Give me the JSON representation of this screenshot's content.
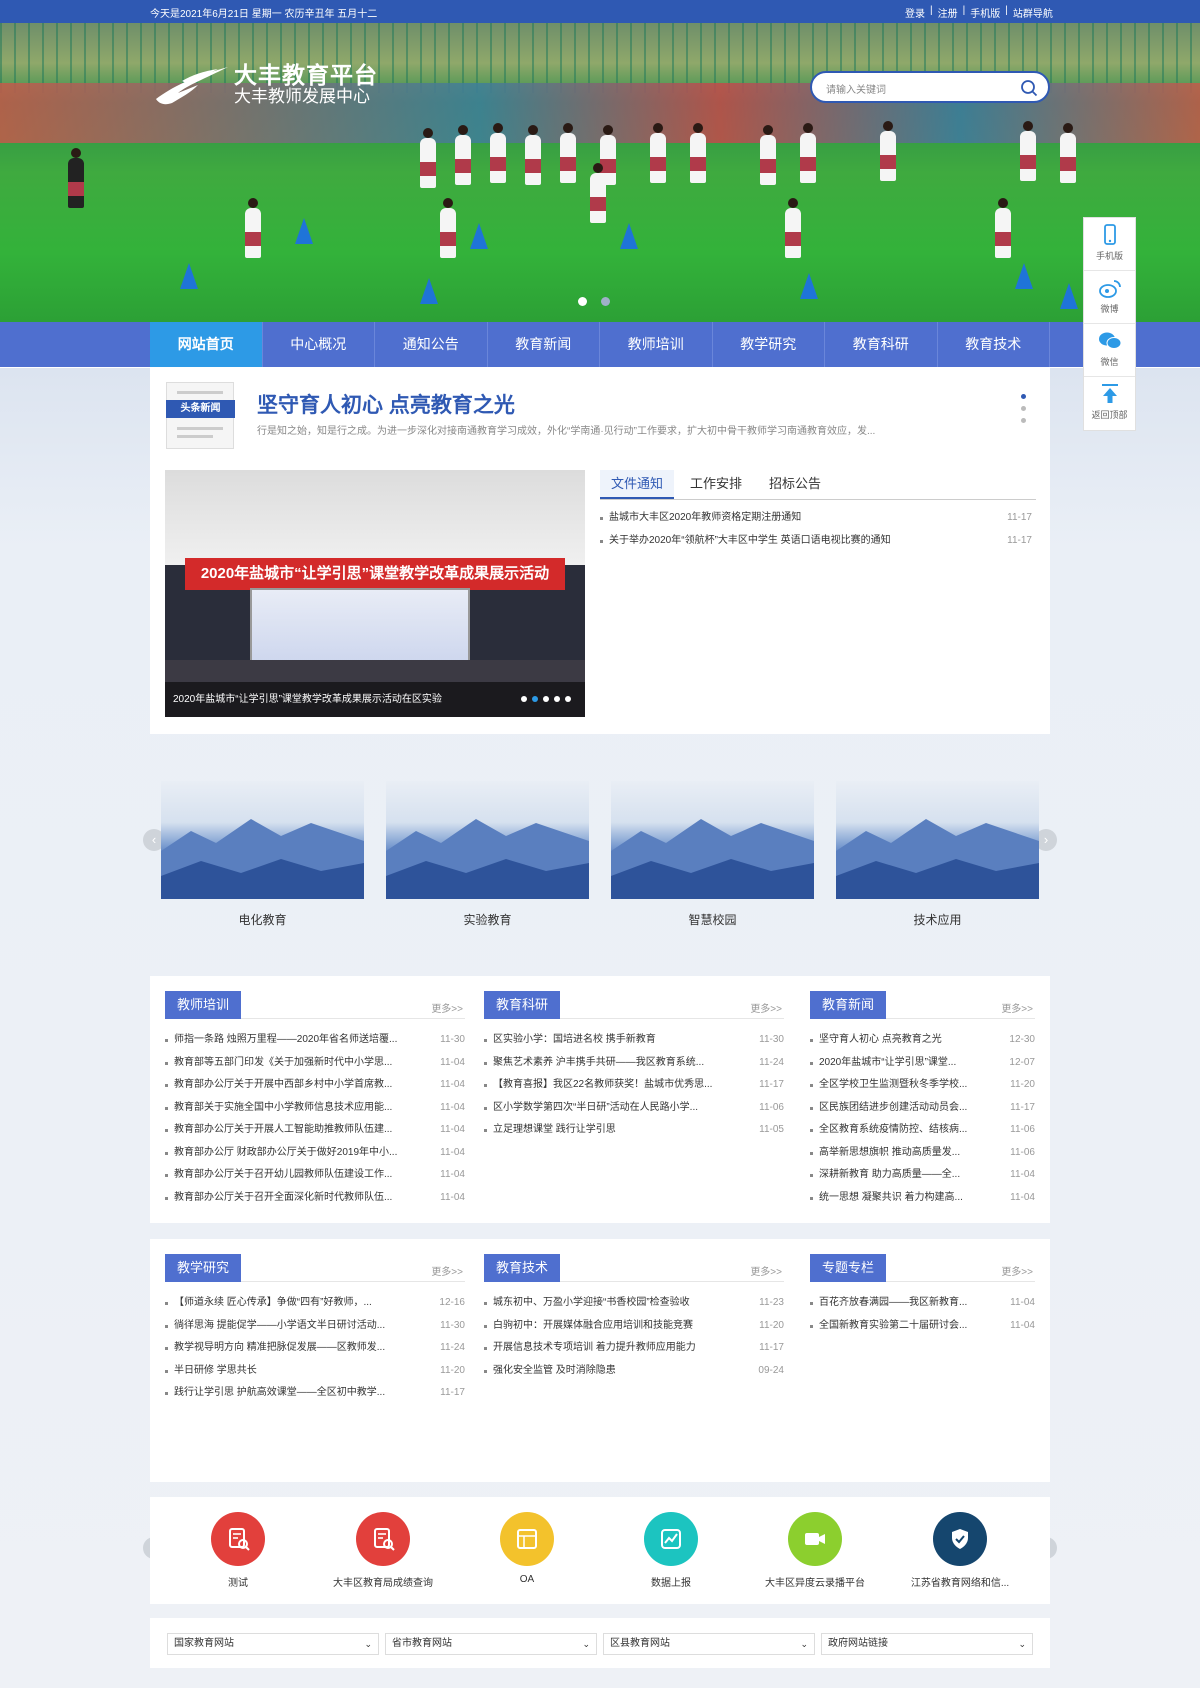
{
  "topbar": {
    "date": "今天是2021年6月21日 星期一 农历辛丑年 五月十二",
    "links": [
      "登录",
      "注册",
      "手机版",
      "站群导航"
    ]
  },
  "logo": {
    "title": "大丰教育平台",
    "subtitle": "大丰教师发展中心"
  },
  "search": {
    "placeholder": "请输入关键词"
  },
  "nav": [
    "网站首页",
    "中心概况",
    "通知公告",
    "教育新闻",
    "教师培训",
    "教学研究",
    "教育科研",
    "教育技术"
  ],
  "sidefloat": [
    "手机版",
    "微博",
    "微信",
    "返回顶部"
  ],
  "headline": {
    "badge": "头条新闻",
    "title": "坚守育人初心 点亮教育之光",
    "summary": "行是知之始，知是行之成。为进一步深化对接南通教育学习成效，外化“学南通·见行动”工作要求，扩大初中骨干教师学习南通教育效应，发..."
  },
  "photo": {
    "banner": "2020年盐城市“让学引思”课堂教学改革成果展示活动",
    "caption": "2020年盐城市“让学引思”课堂教学改革成果展示活动在区实验"
  },
  "notice_tabs": [
    "文件通知",
    "工作安排",
    "招标公告"
  ],
  "notices": [
    {
      "title": "盐城市大丰区2020年教师资格定期注册通知",
      "date": "11-17"
    },
    {
      "title": "关于举办2020年“领航杯”大丰区中学生 英语口语电视比赛的通知",
      "date": "11-17"
    }
  ],
  "gallery": [
    "电化教育",
    "实验教育",
    "智慧校园",
    "技术应用"
  ],
  "more_label": "更多>>",
  "columns": [
    {
      "title": "教师培训",
      "items": [
        {
          "t": "师指一条路 烛照万里程——2020年省名师送培覆...",
          "d": "11-30"
        },
        {
          "t": "教育部等五部门印发《关于加强新时代中小学思...",
          "d": "11-04"
        },
        {
          "t": "教育部办公厅关于开展中西部乡村中小学首席教...",
          "d": "11-04"
        },
        {
          "t": "教育部关于实施全国中小学教师信息技术应用能...",
          "d": "11-04"
        },
        {
          "t": "教育部办公厅关于开展人工智能助推教师队伍建...",
          "d": "11-04"
        },
        {
          "t": "教育部办公厅 财政部办公厅关于做好2019年中小...",
          "d": "11-04"
        },
        {
          "t": "教育部办公厅关于召开幼儿园教师队伍建设工作...",
          "d": "11-04"
        },
        {
          "t": "教育部办公厅关于召开全面深化新时代教师队伍...",
          "d": "11-04"
        }
      ]
    },
    {
      "title": "教育科研",
      "items": [
        {
          "t": "区实验小学：国培进名校 携手新教育",
          "d": "11-30"
        },
        {
          "t": "聚焦艺术素养 沪丰携手共研——我区教育系统...",
          "d": "11-24"
        },
        {
          "t": "【教育喜报】我区22名教师获奖！盐城市优秀思...",
          "d": "11-17"
        },
        {
          "t": "区小学数学第四次“半日研”活动在人民路小学...",
          "d": "11-06"
        },
        {
          "t": "立足理想课堂 践行让学引思",
          "d": "11-05"
        }
      ]
    },
    {
      "title": "教育新闻",
      "items": [
        {
          "t": "坚守育人初心 点亮教育之光",
          "d": "12-30"
        },
        {
          "t": "2020年盐城市“让学引思”课堂...",
          "d": "12-07"
        },
        {
          "t": "全区学校卫生监测暨秋冬季学校...",
          "d": "11-20"
        },
        {
          "t": "区民族团结进步创建活动动员会...",
          "d": "11-17"
        },
        {
          "t": "全区教育系统疫情防控、结核病...",
          "d": "11-06"
        },
        {
          "t": "高举新思想旗帜 推动高质量发...",
          "d": "11-06"
        },
        {
          "t": "深耕新教育 助力高质量——全...",
          "d": "11-04"
        },
        {
          "t": "统一思想 凝聚共识 着力构建高...",
          "d": "11-04"
        }
      ]
    },
    {
      "title": "教学研究",
      "items": [
        {
          "t": "【师道永续 匠心传承】争做“四有”好教师，...",
          "d": "12-16"
        },
        {
          "t": "徜徉思海 提能促学——小学语文半日研讨活动...",
          "d": "11-30"
        },
        {
          "t": "教学视导明方向 精准把脉促发展——区教师发...",
          "d": "11-24"
        },
        {
          "t": "半日研修 学思共长",
          "d": "11-20"
        },
        {
          "t": "践行让学引思 护航高效课堂——全区初中教学...",
          "d": "11-17"
        }
      ]
    },
    {
      "title": "教育技术",
      "items": [
        {
          "t": "城东初中、万盈小学迎接“书香校园”检查验收",
          "d": "11-23"
        },
        {
          "t": "白驹初中：开展媒体融合应用培训和技能竞赛",
          "d": "11-20"
        },
        {
          "t": "开展信息技术专项培训 着力提升教师应用能力",
          "d": "11-17"
        },
        {
          "t": "强化安全监管 及时消除隐患",
          "d": "09-24"
        }
      ]
    },
    {
      "title": "专题专栏",
      "items": [
        {
          "t": "百花齐放春满园——我区新教育...",
          "d": "11-04"
        },
        {
          "t": "全国新教育实验第二十届研讨会...",
          "d": "11-04"
        }
      ]
    }
  ],
  "quick": [
    {
      "label": "测试",
      "color": "#e2403c"
    },
    {
      "label": "大丰区教育局成绩查询",
      "color": "#e2403c"
    },
    {
      "label": "OA",
      "color": "#f3c22c"
    },
    {
      "label": "数据上报",
      "color": "#1cc4c0"
    },
    {
      "label": "大丰区异度云录播平台",
      "color": "#8ccf2e"
    },
    {
      "label": "江苏省教育网络和信...",
      "color": "#15466e"
    }
  ],
  "selects": [
    "国家教育网站",
    "省市教育网站",
    "区县教育网站",
    "政府网站链接"
  ],
  "theme": {
    "primary": "#2f59b3",
    "nav": "#4f6fcf",
    "nav_active": "#2d9ae6"
  }
}
